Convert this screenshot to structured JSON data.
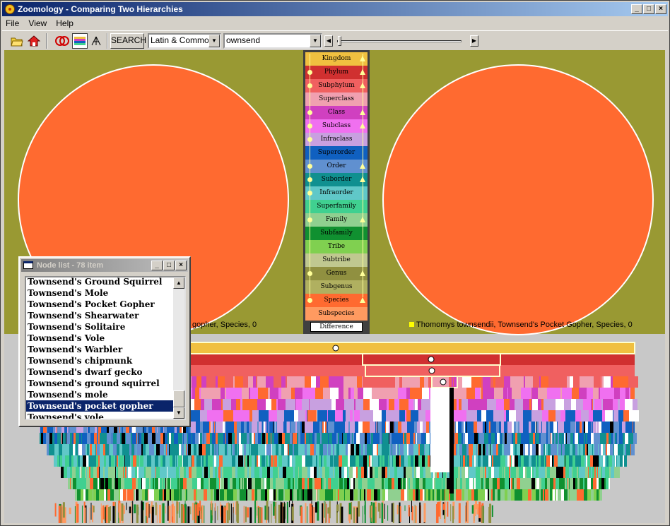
{
  "window": {
    "title": "Zoomology - Comparing Two Hierarchies"
  },
  "menu": [
    "File",
    "View",
    "Help"
  ],
  "toolbar": {
    "search_label": "SEARCH",
    "name_mode": "Latin & Common",
    "search_text": "ownsend"
  },
  "left_tree": {
    "caption": "gopher, Species, 0",
    "color": "#ff6a30"
  },
  "right_tree": {
    "caption": "Thomomys townsendii, Townsend's Pocket Gopher, Species, 0",
    "color": "#ff6a30",
    "marker_color": "#ffff00"
  },
  "ranks": [
    {
      "name": "Kingdom",
      "color": "#f0c040",
      "dot": false,
      "tri": true
    },
    {
      "name": "Phylum",
      "color": "#d03030",
      "dot": true,
      "tri": true
    },
    {
      "name": "Subphylum",
      "color": "#f06060",
      "dot": true,
      "tri": true
    },
    {
      "name": "Superclass",
      "color": "#f0a0b0",
      "dot": false,
      "tri": false
    },
    {
      "name": "Class",
      "color": "#d040c0",
      "dot": true,
      "tri": true
    },
    {
      "name": "Subclass",
      "color": "#f070f0",
      "dot": true,
      "tri": true
    },
    {
      "name": "Infraclass",
      "color": "#c8a0e0",
      "dot": true,
      "tri": false
    },
    {
      "name": "Superorder",
      "color": "#1060c0",
      "dot": false,
      "tri": false
    },
    {
      "name": "Order",
      "color": "#6090d0",
      "dot": true,
      "tri": true
    },
    {
      "name": "Suborder",
      "color": "#109090",
      "dot": true,
      "tri": true
    },
    {
      "name": "Infraorder",
      "color": "#60c8c8",
      "dot": true,
      "tri": false
    },
    {
      "name": "Superfamily",
      "color": "#40d090",
      "dot": false,
      "tri": false
    },
    {
      "name": "Family",
      "color": "#90d090",
      "dot": true,
      "tri": true
    },
    {
      "name": "Subfamily",
      "color": "#109030",
      "dot": false,
      "tri": false
    },
    {
      "name": "Tribe",
      "color": "#80d050",
      "dot": false,
      "tri": false
    },
    {
      "name": "Subtribe",
      "color": "#c0c890",
      "dot": false,
      "tri": false
    },
    {
      "name": "Genus",
      "color": "#909040",
      "dot": true,
      "tri": true
    },
    {
      "name": "Subgenus",
      "color": "#b0b060",
      "dot": false,
      "tri": false
    },
    {
      "name": "Species",
      "color": "#ff6a30",
      "dot": true,
      "tri": true
    },
    {
      "name": "Subspecies",
      "color": "#ff9a60",
      "dot": false,
      "tri": false
    }
  ],
  "difference_label": "Difference",
  "nodelist": {
    "title": "Node list - 78 item",
    "items": [
      "Townsend's Ground Squirrel",
      "Townsend's Mole",
      "Townsend's Pocket Gopher",
      "Townsend's Shearwater",
      "Townsend's Solitaire",
      "Townsend's Vole",
      "Townsend's Warbler",
      "Townsend's chipmunk",
      "Townsend's dwarf gecko",
      "Townsend's ground squirrel",
      "Townsend's mole",
      "Townsend's pocket gopher",
      "Townsend's vole"
    ],
    "selected_index": 11
  }
}
